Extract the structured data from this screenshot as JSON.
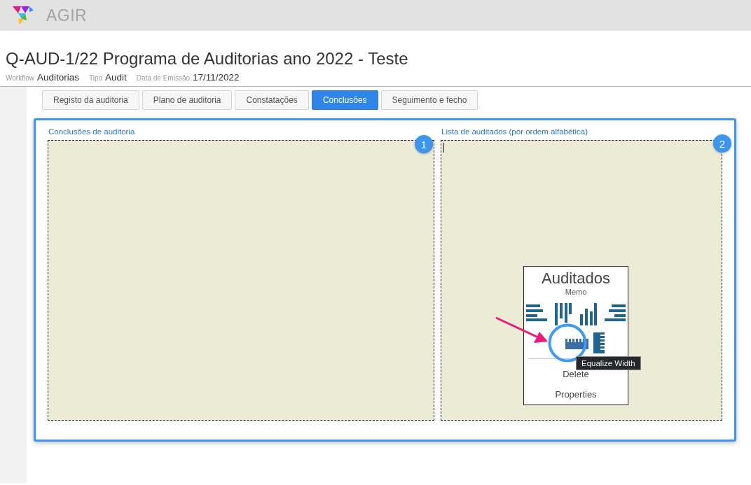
{
  "app": {
    "name": "AGIR"
  },
  "document": {
    "title": "Q-AUD-1/22 Programa de Auditorias ano 2022 - Teste",
    "meta": [
      {
        "label": "Workflow",
        "value": "Auditorias"
      },
      {
        "label": "Tipo",
        "value": "Audit"
      },
      {
        "label": "Data de Emissão",
        "value": "17/11/2022"
      }
    ]
  },
  "tabs": [
    {
      "label": "Registo da auditoria",
      "selected": false
    },
    {
      "label": "Plano de auditoria",
      "selected": false
    },
    {
      "label": "Constatações",
      "selected": false
    },
    {
      "label": "Conclusões",
      "selected": true
    },
    {
      "label": "Seguimento e fecho",
      "selected": false
    }
  ],
  "panels": [
    {
      "label": "Conclusões de auditoria",
      "badge": "1",
      "focused": false
    },
    {
      "label": "Lista de auditados (por ordem alfabética)",
      "badge": "2",
      "focused": true
    }
  ],
  "context_menu": {
    "title": "Auditados",
    "subtitle": "Memo",
    "items": [
      "Delete",
      "Properties"
    ],
    "tooltip": "Equalize Width"
  }
}
